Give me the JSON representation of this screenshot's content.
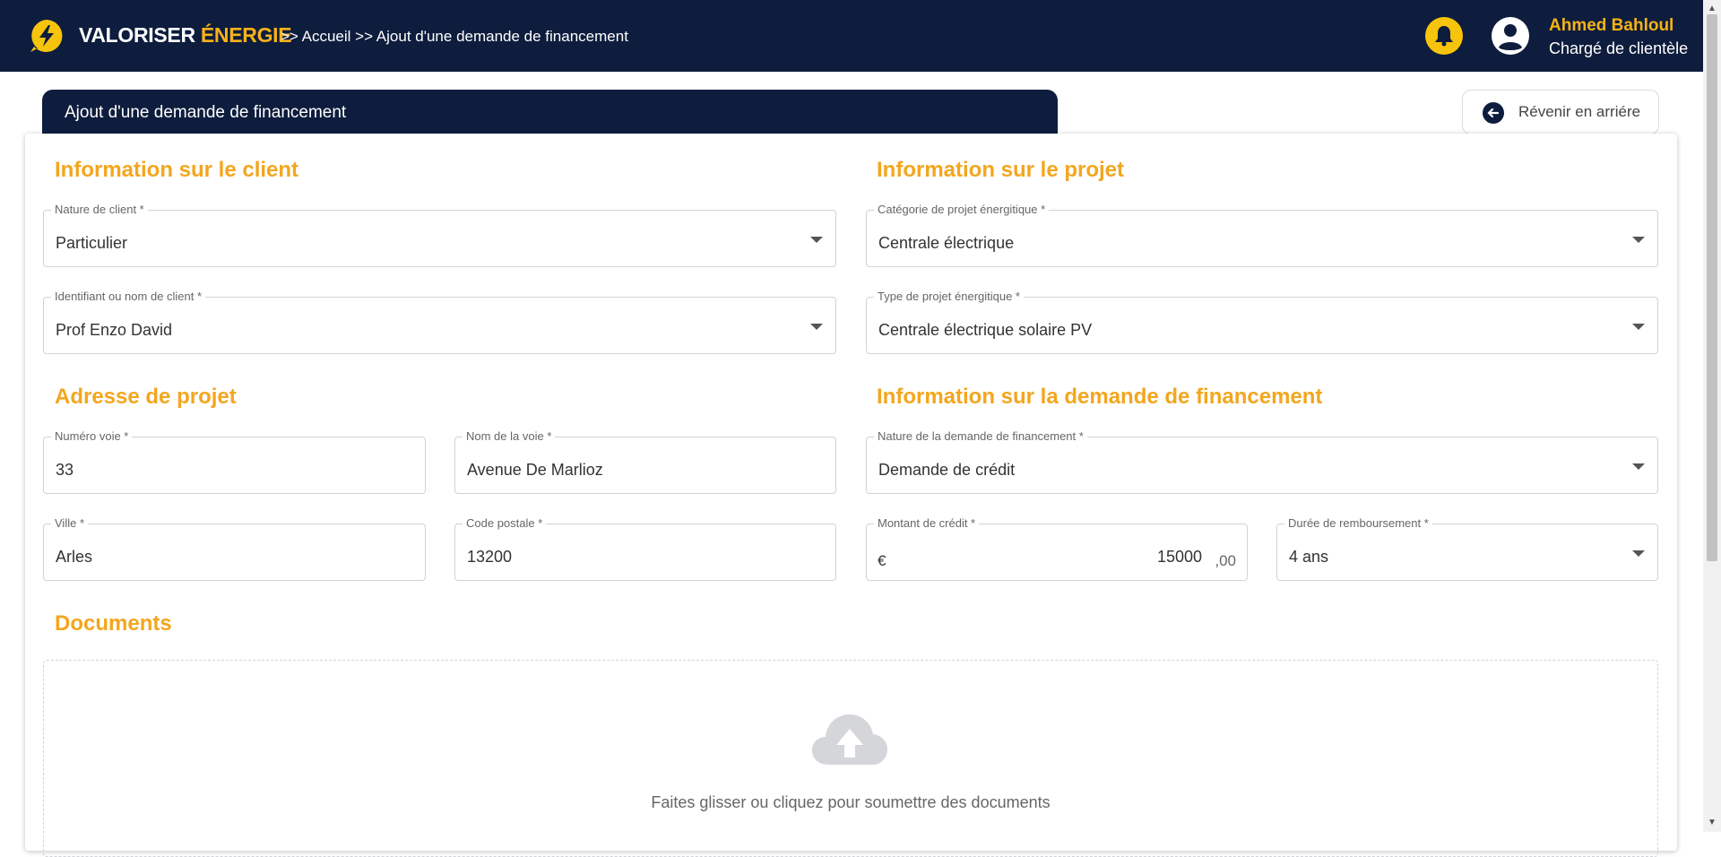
{
  "header": {
    "brand_left": "VALORISER",
    "brand_accent": "ÉNERGIE",
    "breadcrumb": ">> Accueil >> Ajout d'une demande de financement",
    "user_name": "Ahmed Bahloul",
    "user_role": "Chargé de clientèle",
    "accent_color": "#f7b218",
    "bg_color": "#0e1d3d"
  },
  "page": {
    "title": "Ajout d'une demande de financement",
    "back_label": "Révenir en arriére"
  },
  "client": {
    "section_title": "Information sur le client",
    "nature_label": "Nature de client *",
    "nature_value": "Particulier",
    "ident_label": "Identifiant ou nom de client *",
    "ident_value": "Prof Enzo David"
  },
  "projet": {
    "section_title": "Information sur le projet",
    "categorie_label": "Catégorie de projet énergitique *",
    "categorie_value": "Centrale électrique",
    "type_label": "Type de projet énergitique *",
    "type_value": "Centrale électrique solaire PV"
  },
  "adresse": {
    "section_title": "Adresse de projet",
    "numero_label": "Numéro voie *",
    "numero_value": "33",
    "voie_label": "Nom de la voie *",
    "voie_value": "Avenue De Marlioz",
    "ville_label": "Ville *",
    "ville_value": "Arles",
    "cp_label": "Code postale *",
    "cp_value": "13200"
  },
  "financement": {
    "section_title": "Information sur la demande de financement",
    "nature_label": "Nature de la demande de financement *",
    "nature_value": "Demande de crédit",
    "montant_label": "Montant de crédit *",
    "currency": "€",
    "montant_value": "15000",
    "montant_cents": ",00",
    "duree_label": "Durée de remboursement *",
    "duree_value": "4 ans"
  },
  "documents": {
    "section_title": "Documents",
    "drop_text": "Faites glisser ou cliquez pour soumettre des documents"
  }
}
